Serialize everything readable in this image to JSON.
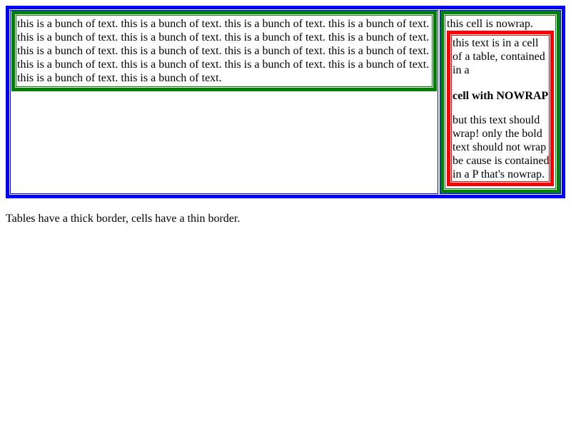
{
  "left_cell": {
    "text": "this is a bunch of text. this is a bunch of text. this is a bunch of text. this is a bunch of text. this is a bunch of text. this is a bunch of text. this is a bunch of text. this is a bunch of text. this is a bunch of text. this is a bunch of text. this is a bunch of text. this is a bunch of text. this is a bunch of text. this is a bunch of text. this is a bunch of text. this is a bunch of text. this is a bunch of text. this is a bunch of text."
  },
  "right_cell": {
    "nowrap_text": "this cell is nowrap.",
    "inner": {
      "text_before": "this text is in a cell of a table, contained in a",
      "bold_text": "cell with NOWRAP",
      "text_after": "but this text should wrap! only the bold text should not wrap be cause is contained in a P that's nowrap."
    }
  },
  "caption": "Tables have a thick border, cells have a thin border.",
  "colors": {
    "outer_table": "#0000ff",
    "inner_tables": "#008000",
    "nested_table": "#ff0000"
  }
}
